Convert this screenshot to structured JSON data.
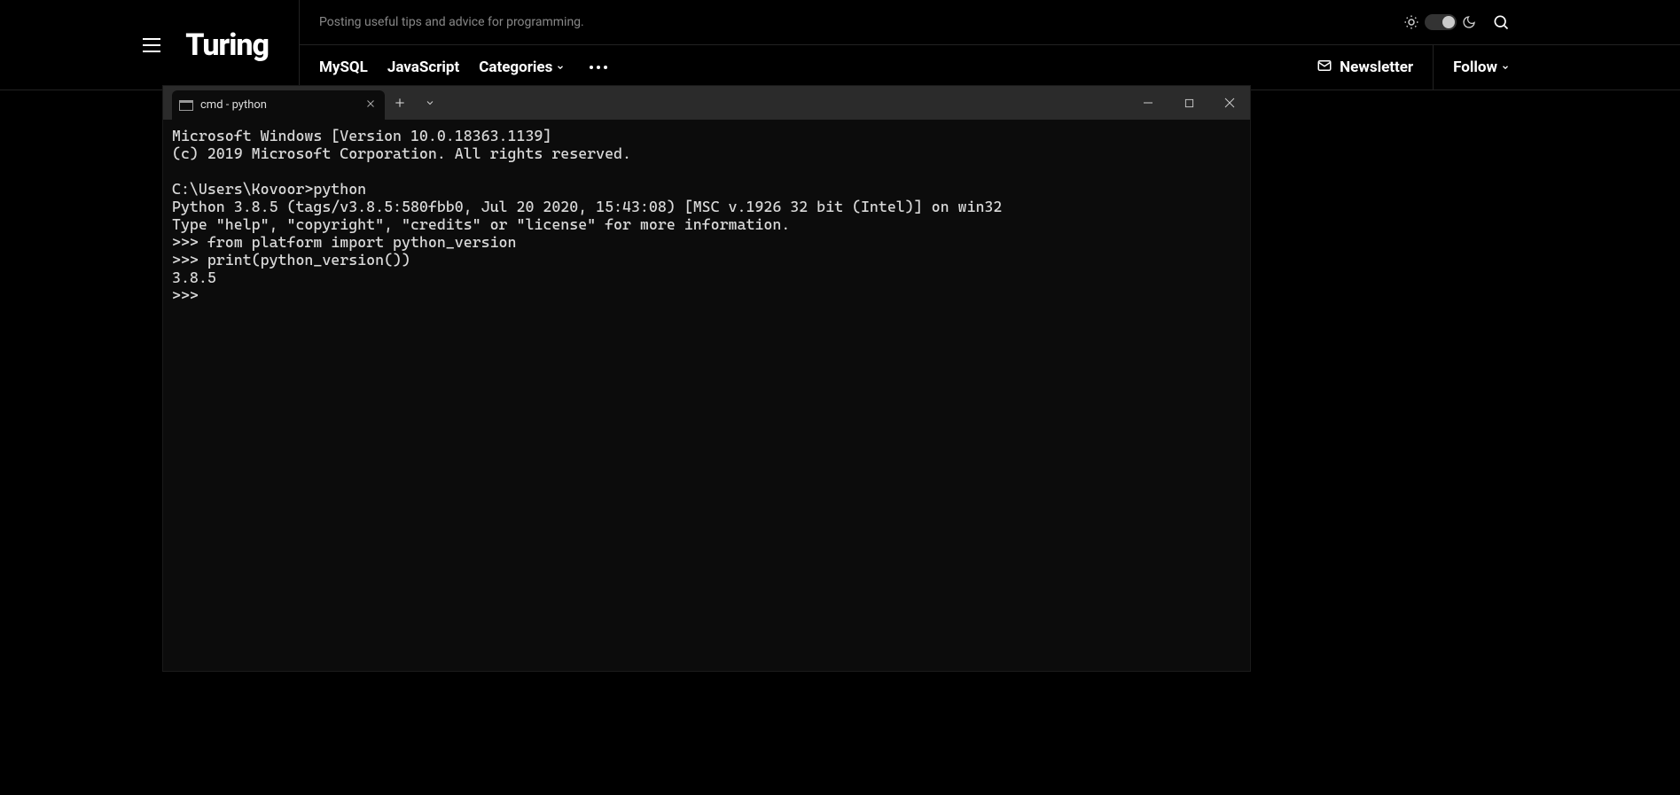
{
  "site": {
    "brand": "Turing",
    "tagline": "Posting useful tips and advice for programming.",
    "nav": {
      "items": [
        "MySQL",
        "JavaScript",
        "Categories"
      ],
      "newsletter": "Newsletter",
      "follow": "Follow"
    }
  },
  "terminal": {
    "tab_title": "cmd - python",
    "lines": [
      "Microsoft Windows [Version 10.0.18363.1139]",
      "(c) 2019 Microsoft Corporation. All rights reserved.",
      "",
      "C:\\Users\\Kovoor>python",
      "Python 3.8.5 (tags/v3.8.5:580fbb0, Jul 20 2020, 15:43:08) [MSC v.1926 32 bit (Intel)] on win32",
      "Type \"help\", \"copyright\", \"credits\" or \"license\" for more information.",
      ">>> from platform import python_version",
      ">>> print(python_version())",
      "3.8.5",
      ">>>"
    ]
  }
}
